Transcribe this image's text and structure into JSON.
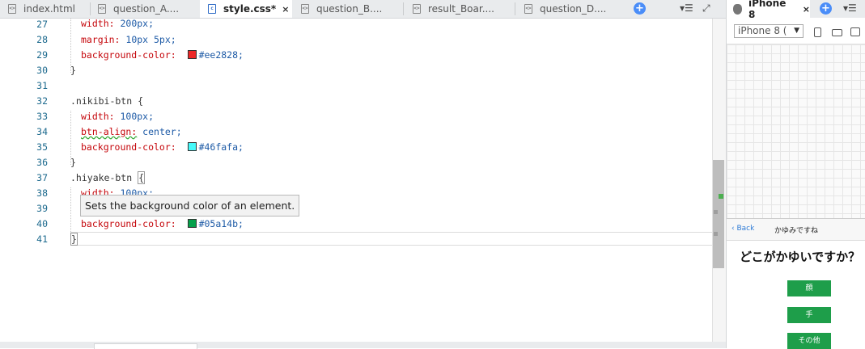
{
  "editor": {
    "tabs": [
      {
        "label": "index.html",
        "close": ""
      },
      {
        "label": "question_A....",
        "close": ""
      },
      {
        "label": "style.css*",
        "close": "×"
      },
      {
        "label": "question_B....",
        "close": ""
      },
      {
        "label": "result_Boar....",
        "close": ""
      },
      {
        "label": "question_D....",
        "close": ""
      }
    ],
    "active_tab": "style.css*",
    "line_numbers": [
      "27",
      "28",
      "29",
      "30",
      "31",
      "32",
      "33",
      "34",
      "35",
      "36",
      "37",
      "38",
      "39",
      "40",
      "41"
    ],
    "code": {
      "l27_prop": "width:",
      "l27_val": " 200px;",
      "l28_prop": "margin:",
      "l28_val": " 10px 5px;",
      "l29_prop": "background-color:",
      "l29_val": "#ee2828;",
      "l29_color": "#ee2828",
      "l30": "}",
      "l32": ".nikibi-btn {",
      "l33_prop": "width:",
      "l33_val": " 100px;",
      "l34_prop": "btn-align:",
      "l34_val": " center;",
      "l35_prop": "background-color:",
      "l35_val": "#46fafa;",
      "l35_color": "#46fafa",
      "l36": "}",
      "l37_sel": ".hiyake-btn ",
      "l37_brace": "{",
      "l38_prop": "width:",
      "l38_val": " 100px;",
      "l40_prop": "background-color:",
      "l40_val": "#05a14b;",
      "l40_color": "#05a14b",
      "l41": "}"
    },
    "tooltip": "Sets the background color of an element."
  },
  "preview": {
    "tab_label": "iPhone 8",
    "tab_close": "×",
    "device_select": "iPhone 8 (",
    "phone": {
      "back": "Back",
      "nav_title": "かゆみですね",
      "question": "どこがかゆいですか？",
      "buttons": [
        "顔",
        "手",
        "その他"
      ],
      "button_color": "#1e9e4a"
    }
  },
  "icons": {
    "new_tab": "plus-circle-icon",
    "tab_menu": "menu-icon",
    "fullscreen": "expand-icon",
    "apple": "apple-icon",
    "device_phone": "phone-portrait-icon",
    "device_landscape": "phone-landscape-icon",
    "device_rotate": "rotate-icon"
  }
}
